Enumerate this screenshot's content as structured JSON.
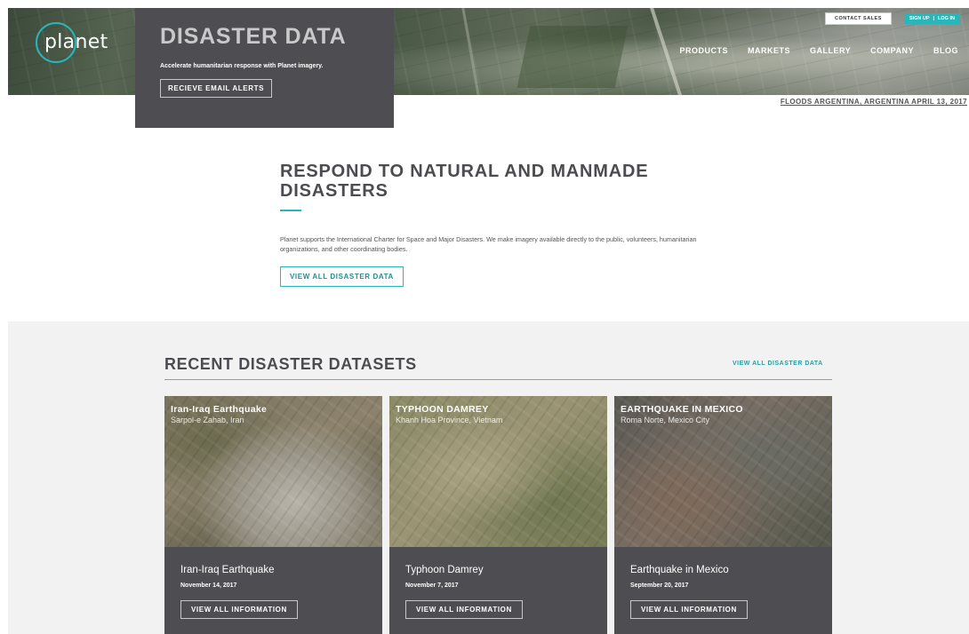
{
  "header": {
    "logo_text": "planet",
    "contact_label": "CONTACT SALES",
    "signup_label": "SIGN UP",
    "divider": "|",
    "login_label": "LOG IN",
    "nav": [
      "PRODUCTS",
      "MARKETS",
      "GALLERY",
      "COMPANY",
      "BLOG"
    ],
    "image_caption": "FLOODS ARGENTINA, ARGENTINA APRIL 13, 2017"
  },
  "hero_box": {
    "title": "DISASTER DATA",
    "subtitle": "Accelerate humanitarian response with Planet imagery.",
    "button": "RECIEVE EMAIL ALERTS"
  },
  "respond": {
    "heading": "RESPOND TO NATURAL AND MANMADE DISASTERS",
    "body": "Planet supports the International Charter for Space and Major Disasters. We make imagery available directly to the public, volunteers, humanitarian organizations, and other coordinating bodies.",
    "button": "VIEW ALL DISASTER DATA"
  },
  "recent": {
    "heading": "RECENT DISASTER DATASETS",
    "link": "VIEW ALL DISASTER DATA",
    "cards": [
      {
        "image_title": "Iran-Iraq Earthquake",
        "image_location": "Sarpol-e Zahab, Iran",
        "name": "Iran-Iraq Earthquake",
        "date": "November 14, 2017",
        "button": "VIEW ALL INFORMATION"
      },
      {
        "image_title": "TYPHOON DAMREY",
        "image_location": "Khanh Hoa Province, Vietnam",
        "name": "Typhoon Damrey",
        "date": "November 7, 2017",
        "button": "VIEW ALL INFORMATION"
      },
      {
        "image_title": "EARTHQUAKE IN MEXICO",
        "image_location": "Roma Norte, Mexico City",
        "name": "Earthquake in Mexico",
        "date": "September 20, 2017",
        "button": "VIEW ALL INFORMATION"
      }
    ]
  },
  "colors": {
    "accent": "#27b6ba",
    "panel": "#4e4d51",
    "section_bg": "#f2f2f2"
  }
}
